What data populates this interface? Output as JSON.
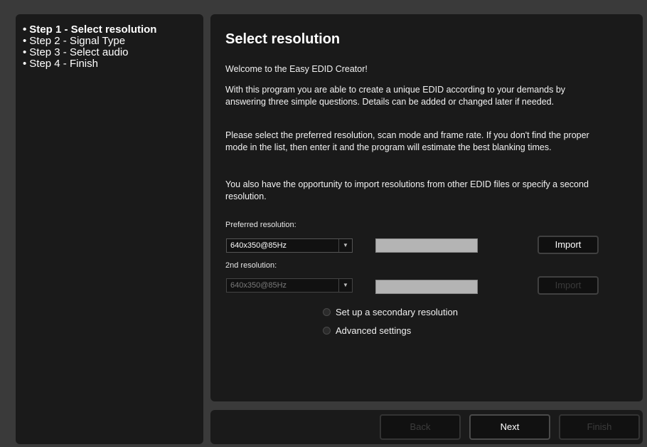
{
  "steps": [
    {
      "label": "Step 1 - Select resolution",
      "active": true
    },
    {
      "label": "Step 2 - Signal Type",
      "active": false
    },
    {
      "label": "Step 3 - Select audio",
      "active": false
    },
    {
      "label": "Step 4 - Finish",
      "active": false
    }
  ],
  "bullet": "•",
  "main": {
    "title": "Select resolution",
    "welcome": "Welcome to the Easy EDID Creator!",
    "para1": "With this program you are able to create a unique EDID according to your demands by answering three simple questions. Details can be added or changed later if needed.",
    "para2": "Please select the preferred resolution, scan mode and frame rate. If you don't find the proper mode in the list, then enter it and the program will estimate the best blanking times.",
    "para3": "You also have the opportunity to import resolutions from other EDID files or specify a second resolution.",
    "preferred_label": "Preferred resolution:",
    "preferred_value": "640x350@85Hz",
    "second_label": "2nd resolution:",
    "second_value": "640x350@85Hz",
    "import_label": "Import",
    "import2_label": "Import",
    "radio_secondary": "Set up a secondary resolution",
    "radio_advanced": "Advanced settings"
  },
  "footer": {
    "back": "Back",
    "next": "Next",
    "finish": "Finish"
  },
  "icons": {
    "dropdown": "chevron-down-icon",
    "radio": "radio-icon"
  }
}
